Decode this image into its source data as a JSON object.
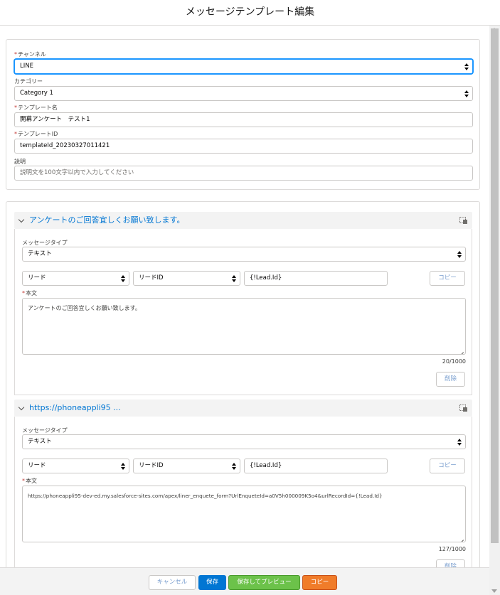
{
  "modal": {
    "title": "メッセージテンプレート編集"
  },
  "required_mark": "*",
  "form": {
    "channel": {
      "label": "チャンネル",
      "value": "LINE"
    },
    "category": {
      "label": "カテゴリー",
      "value": "Category 1"
    },
    "template_name": {
      "label": "テンプレート名",
      "value": "開幕アンケート　テスト1"
    },
    "template_id": {
      "label": "テンプレートID",
      "value": "templateId_20230327011421"
    },
    "description": {
      "label": "説明",
      "placeholder": "説明文を100文字以内で入力してください"
    }
  },
  "messages": [
    {
      "header_title": "アンケートのご回答宜しくお願い致します。",
      "type_label": "メッセージタイプ",
      "type_value": "テキスト",
      "object_value": "リード",
      "field_value": "リードID",
      "merge_value": "{!Lead.Id}",
      "copy_label": "コピー",
      "body_label": "本文",
      "body_text": "アンケートのご回答宜しくお願い致します。",
      "count": "20/1000",
      "delete_label": "削除"
    },
    {
      "header_title": "https://phoneappli95 ...",
      "type_label": "メッセージタイプ",
      "type_value": "テキスト",
      "object_value": "リード",
      "field_value": "リードID",
      "merge_value": "{!Lead.Id}",
      "copy_label": "コピー",
      "body_label": "本文",
      "body_text": "https://phoneappli95-dev-ed.my.salesforce-sites.com/apex/liner_enquete_form?UrlEnqueteId=a0V5h000009K5o4&urlRecordId={!Lead.Id}",
      "count": "127/1000",
      "delete_label": "削除"
    }
  ],
  "footer": {
    "cancel": "キャンセル",
    "save": "保存",
    "save_preview": "保存してプレビュー",
    "copy": "コピー"
  },
  "colors": {
    "brand": "#0176d3",
    "save_preview": "#6cc24a",
    "copy": "#f07c2a",
    "required": "#c23934"
  }
}
